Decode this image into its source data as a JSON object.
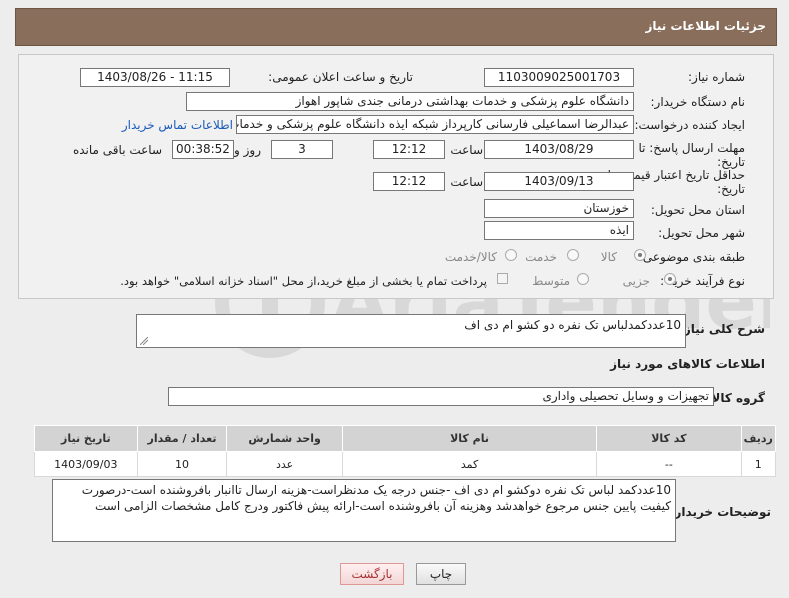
{
  "header": {
    "title": "جزئیات اطلاعات نیاز"
  },
  "form": {
    "need_number_label": "شماره نیاز:",
    "need_number": "1103009025001703",
    "announce_label": "تاریخ و ساعت اعلان عمومی:",
    "announce_value": "1403/08/26 - 11:15",
    "buyer_label": "نام دستگاه خریدار:",
    "buyer_value": "دانشگاه علوم پزشکی و خدمات بهداشتی درمانی جندی شاپور اهواز",
    "creator_label": "ایجاد کننده درخواست:",
    "creator_value": "عبدالرضا اسماعیلی فارسانی کارپرداز شبکه ایذه دانشگاه علوم پزشکی و خدمات",
    "contact_link": "اطلاعات تماس خریدار",
    "deadline_label_1": "مهلت ارسال پاسخ: تا",
    "deadline_label_2": "تاریخ:",
    "deadline_date": "1403/08/29",
    "deadline_time_label": "ساعت",
    "deadline_time": "12:12",
    "days_value": "3",
    "days_label": "روز و",
    "remaining_time": "00:38:52",
    "remaining_label": "ساعت باقی مانده",
    "validity_label_1": "حداقل تاریخ اعتبار قیمت: تا",
    "validity_label_2": "تاریخ:",
    "validity_date": "1403/09/13",
    "validity_time_label": "ساعت",
    "validity_time": "12:12",
    "province_label": "استان محل تحویل:",
    "province_value": "خوزستان",
    "city_label": "شهر محل تحویل:",
    "city_value": "ایذه",
    "category_label": "طبقه بندی موضوعی:",
    "category_options": [
      "کالا",
      "خدمت",
      "کالا/خدمت"
    ],
    "category_selected": "کالا",
    "process_label": "نوع فرآیند خرید :",
    "process_options": [
      "جزیی",
      "متوسط"
    ],
    "process_selected": "جزیی",
    "payment_note": "پرداخت تمام یا بخشی از مبلغ خرید،از محل \"اسناد خزانه اسلامی\" خواهد بود."
  },
  "description": {
    "label": "شرح کلی نیاز:",
    "value": "10عددکمدلباس تک نفره دو کشو ام دی اف"
  },
  "goods": {
    "section_title": "اطلاعات کالاهای مورد نیاز",
    "group_label": "گروه کالا:",
    "group_value": "تجهیزات و وسایل تحصیلی واداری",
    "columns": [
      "ردیف",
      "کد کالا",
      "نام کالا",
      "واحد شمارش",
      "تعداد / مقدار",
      "تاریخ نیاز"
    ],
    "rows": [
      {
        "row": "1",
        "code": "--",
        "name": "کمد",
        "unit": "عدد",
        "qty": "10",
        "date": "1403/09/03"
      }
    ]
  },
  "buyer_notes": {
    "label": "توضیحات خریدار:",
    "value": "10عددکمد لباس تک نفره دوکشو ام دی اف -جنس درجه یک مدنظراست-هزینه ارسال تاانبار بافروشنده است-درصورت کیفیت پایین جنس مرجوع خواهدشد وهزینه آن بافروشنده است-ارائه پیش فاکتور ودرج کامل مشخصات الزامی است"
  },
  "buttons": {
    "print": "چاپ",
    "back": "بازگشت"
  },
  "watermark": {
    "text": "AriaTender.neT"
  }
}
